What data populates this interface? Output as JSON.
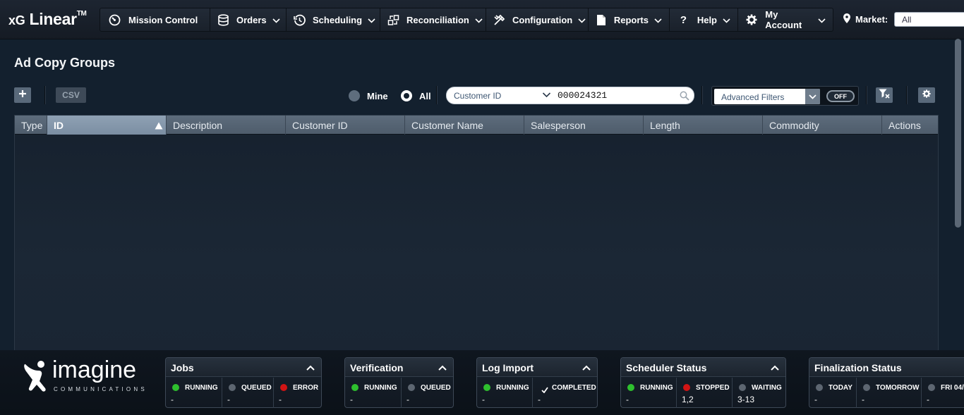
{
  "app": {
    "brand": "xG Linear",
    "brand_prefix": "xG",
    "brand_main": "Linear",
    "brand_tm": "TM"
  },
  "nav": [
    {
      "label": "Mission Control",
      "icon": "dashboard-icon"
    },
    {
      "label": "Orders",
      "icon": "database-icon"
    },
    {
      "label": "Scheduling",
      "icon": "clock-icon"
    },
    {
      "label": "Reconciliation",
      "icon": "reconcile-icon"
    },
    {
      "label": "Configuration",
      "icon": "tools-icon"
    },
    {
      "label": "Reports",
      "icon": "document-icon"
    },
    {
      "label": "Help",
      "icon": "question-icon"
    },
    {
      "label": "My Account",
      "icon": "gear-icon"
    }
  ],
  "market": {
    "label": "Market:",
    "value": "All"
  },
  "page": {
    "title": "Ad Copy Groups"
  },
  "toolbar": {
    "add_label": "+",
    "csv_label": "CSV",
    "mine_label": "Mine",
    "all_label": "All",
    "selected_scope": "All",
    "search_type": "Customer ID",
    "search_value": "000024321",
    "advanced_filters_label": "Advanced Filters",
    "toggle_label": "OFF"
  },
  "table": {
    "columns": [
      "Type",
      "ID",
      "Description",
      "Customer ID",
      "Customer Name",
      "Salesperson",
      "Length",
      "Commodity",
      "Actions"
    ],
    "sorted_column": "ID",
    "sort_direction": "ascending",
    "rows": []
  },
  "footer": {
    "logo_word": "imagine",
    "logo_sub": "COMMUNICATIONS",
    "panels": [
      {
        "title": "Jobs",
        "cells": [
          {
            "label": "RUNNING",
            "status": "green",
            "value": "-"
          },
          {
            "label": "QUEUED",
            "status": "gray",
            "value": "-"
          },
          {
            "label": "ERROR",
            "status": "red",
            "value": "-"
          }
        ]
      },
      {
        "title": "Verification",
        "cells": [
          {
            "label": "RUNNING",
            "status": "green",
            "value": "-"
          },
          {
            "label": "QUEUED",
            "status": "gray",
            "value": "-"
          }
        ]
      },
      {
        "title": "Log Import",
        "cells": [
          {
            "label": "RUNNING",
            "status": "green",
            "value": "-"
          },
          {
            "label": "COMPLETED",
            "status": "check",
            "value": "-"
          }
        ]
      },
      {
        "title": "Scheduler Status",
        "cells": [
          {
            "label": "RUNNING",
            "status": "green",
            "value": "-"
          },
          {
            "label": "STOPPED",
            "status": "red",
            "value": "1,2"
          },
          {
            "label": "WAITING",
            "status": "gray",
            "value": "3-13"
          }
        ]
      },
      {
        "title": "Finalization Status",
        "cells": [
          {
            "label": "TODAY",
            "status": "gray",
            "value": "-"
          },
          {
            "label": "TOMORROW",
            "status": "gray",
            "value": "-"
          },
          {
            "label": "FRI 04/",
            "status": "gray",
            "value": "-"
          }
        ]
      }
    ]
  },
  "colors": {
    "background": "#13202e",
    "header": "#5d6c7c",
    "running": "#2ec02e",
    "error": "#d11414",
    "idle": "#5d6671"
  }
}
